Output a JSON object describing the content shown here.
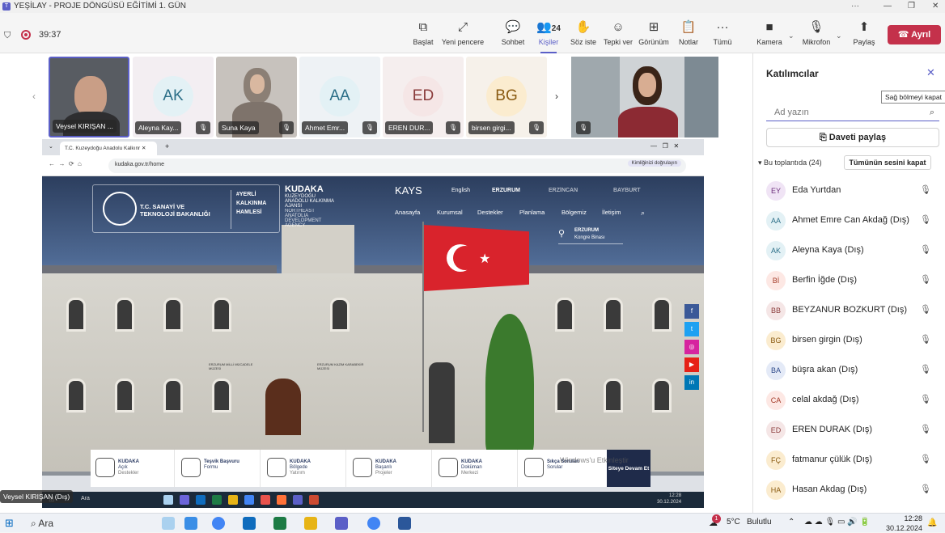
{
  "window": {
    "title": "YEŞİLAY - PROJE DÖNGÜSÜ EĞİTİMİ 1. GÜN"
  },
  "meeting": {
    "timer": "39:37",
    "toolbar": [
      {
        "key": "start",
        "label": "Başlat",
        "icon": "start-icon"
      },
      {
        "key": "newwin",
        "label": "Yeni pencere",
        "icon": "new-window-icon"
      },
      {
        "key": "chat",
        "label": "Sohbet",
        "icon": "chat-icon"
      },
      {
        "key": "people",
        "label": "Kişiler",
        "icon": "people-icon",
        "count": "24"
      },
      {
        "key": "raise",
        "label": "Söz iste",
        "icon": "raise-hand-icon"
      },
      {
        "key": "react",
        "label": "Tepki ver",
        "icon": "reaction-icon"
      },
      {
        "key": "view",
        "label": "Görünüm",
        "icon": "view-icon"
      },
      {
        "key": "notes",
        "label": "Notlar",
        "icon": "notes-icon"
      },
      {
        "key": "more",
        "label": "Tümü",
        "icon": "more-icon"
      },
      {
        "key": "camera",
        "label": "Kamera",
        "icon": "camera-icon"
      },
      {
        "key": "mic",
        "label": "Mikrofon",
        "icon": "mic-icon"
      },
      {
        "key": "share",
        "label": "Paylaş",
        "icon": "share-icon"
      }
    ],
    "leave_label": "Ayrıl"
  },
  "gallery": [
    {
      "name": "Veysel KIRIŞAN ...",
      "video": true,
      "selected": true
    },
    {
      "initials": "AK",
      "name": "Aleyna Kay...",
      "color": "#e3f1f5"
    },
    {
      "name": "Suna Kaya",
      "video": true
    },
    {
      "initials": "AA",
      "name": "Ahmet Emr...",
      "color": "#e3f1f5"
    },
    {
      "initials": "ED",
      "name": "EREN DUR...",
      "color": "#f5e6e6"
    },
    {
      "initials": "BG",
      "name": "birsen girgi...",
      "color": "#fbeccf"
    }
  ],
  "shared_screen": {
    "tab_title": "T.C. Kuzeydoğu Anadolu Kalkınr",
    "url": "kudaka.gov.tr/home",
    "verify_label": "Kimliğinizi doğrulayın",
    "logo_ministry": "T.C. SANAYİ VE\nTEKNOLOJİ BAKANLIĞI",
    "logo_hashtag": "#YERLİ KALKINMA HAMLESİ",
    "logo_kudaka": "KUDAKA",
    "logo_kudaka_sub": "KUZEYDOĞU ANADOLU KALKINMA AJANSI",
    "logo_kudaka_en": "NORTHEAST ANATOLIA DEVELOPMENT AGENCY",
    "sites": [
      "KAYS",
      "English",
      "ERZURUM",
      "ERZİNCAN",
      "BAYBURT"
    ],
    "nav": [
      "Anasayfa",
      "Kurumsal",
      "Destekler",
      "Planlama",
      "Bölgemiz",
      "İletişim"
    ],
    "location_title": "ERZURUM",
    "location_sub": "Kongre Binası",
    "cards": [
      {
        "title": "KUDAKA",
        "sub": "Açık",
        "desc": "Destekler"
      },
      {
        "title": "Teşvik Başvuru",
        "sub": "Formu",
        "desc": ""
      },
      {
        "title": "KUDAKA",
        "sub": "Bölgede",
        "desc": "Yatırım"
      },
      {
        "title": "KUDAKA",
        "sub": "Başarılı",
        "desc": "Projeler"
      },
      {
        "title": "KUDAKA",
        "sub": "Doküman",
        "desc": "Merkezi"
      },
      {
        "title": "Sıkça Sorulan",
        "sub": "Sorular",
        "desc": ""
      }
    ],
    "devam_label": "Siteye Devam Et",
    "watermark": "Windows'u Etkinleştir",
    "inner_search": "Ara",
    "inner_time": "12:28",
    "inner_date": "30.12.2024",
    "building_sign1": "ERZURUM KAZIM KARABEKİR MÜZESİ",
    "building_sign2": "ERZURUM MİLLİ MÜCADELE MÜZESİ"
  },
  "presenter_caption": "Veysel KIRIŞAN (Dış)",
  "panel": {
    "title": "Katılımcılar",
    "tooltip": "Sağ bölmeyi kapat",
    "search_placeholder": "Ad yazın",
    "invite_label": "Daveti paylaş",
    "section_label": "Bu toplantıda (24)",
    "mute_all_label": "Tümünün sesini kapat",
    "participants": [
      {
        "initials": "EY",
        "name": "Eda Yurtdan",
        "color": "#f0e4f5"
      },
      {
        "initials": "AA",
        "name": "Ahmet Emre Can Akdağ (Dış)",
        "color": "#e3f1f5"
      },
      {
        "initials": "AK",
        "name": "Aleyna Kaya (Dış)",
        "color": "#e3f1f5"
      },
      {
        "initials": "Bİ",
        "name": "Berfin İğde (Dış)",
        "color": "#fde8e4"
      },
      {
        "initials": "BB",
        "name": "BEYZANUR BOZKURT (Dış)",
        "color": "#f5e6e6"
      },
      {
        "initials": "BG",
        "name": "birsen girgin (Dış)",
        "color": "#fbeccf"
      },
      {
        "initials": "BA",
        "name": "büşra akan (Dış)",
        "color": "#e4eaf7"
      },
      {
        "initials": "CA",
        "name": "celal akdağ (Dış)",
        "color": "#fde8e4"
      },
      {
        "initials": "ED",
        "name": "EREN DURAK (Dış)",
        "color": "#f5e6e6"
      },
      {
        "initials": "FÇ",
        "name": "fatmanur çülük (Dış)",
        "color": "#fbeccf"
      },
      {
        "initials": "HA",
        "name": "Hasan Akdag (Dış)",
        "color": "#fbeccf"
      }
    ]
  },
  "taskbar": {
    "search_label": "Ara",
    "notification_badge": "1",
    "weather": "5°C",
    "weather_text": "Bulutlu",
    "time": "12:28",
    "date": "30.12.2024"
  }
}
